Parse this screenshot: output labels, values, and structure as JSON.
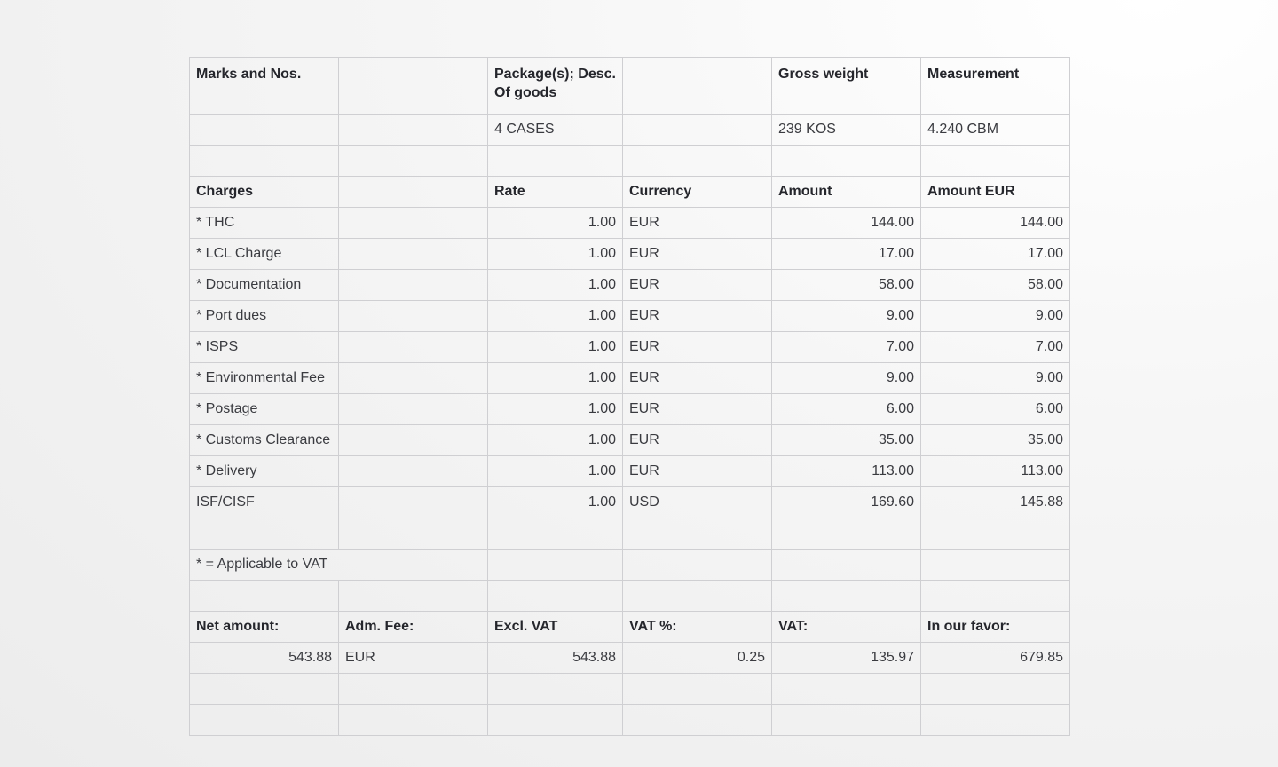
{
  "goods": {
    "headers": [
      "Marks and Nos.",
      "",
      "Package(s); Desc. Of goods",
      "",
      "Gross weight",
      "Measurement"
    ],
    "row": [
      "",
      "",
      "4 CASES",
      "",
      "239 KOS",
      "4.240 CBM"
    ]
  },
  "charges": {
    "headers": [
      "Charges",
      "",
      "Rate",
      "Currency",
      "Amount",
      "Amount EUR"
    ],
    "rows": [
      {
        "name": "* THC",
        "rate": "1.00",
        "currency": "EUR",
        "amount": "144.00",
        "amount_eur": "144.00"
      },
      {
        "name": "* LCL Charge",
        "rate": "1.00",
        "currency": "EUR",
        "amount": "17.00",
        "amount_eur": "17.00"
      },
      {
        "name": "* Documentation",
        "rate": "1.00",
        "currency": "EUR",
        "amount": "58.00",
        "amount_eur": "58.00"
      },
      {
        "name": "* Port dues",
        "rate": "1.00",
        "currency": "EUR",
        "amount": "9.00",
        "amount_eur": "9.00"
      },
      {
        "name": "* ISPS",
        "rate": "1.00",
        "currency": "EUR",
        "amount": "7.00",
        "amount_eur": "7.00"
      },
      {
        "name": "* Environmental Fee",
        "rate": "1.00",
        "currency": "EUR",
        "amount": "9.00",
        "amount_eur": "9.00"
      },
      {
        "name": "* Postage",
        "rate": "1.00",
        "currency": "EUR",
        "amount": "6.00",
        "amount_eur": "6.00"
      },
      {
        "name": "* Customs Clearance",
        "rate": "1.00",
        "currency": "EUR",
        "amount": "35.00",
        "amount_eur": "35.00"
      },
      {
        "name": "* Delivery",
        "rate": "1.00",
        "currency": "EUR",
        "amount": "113.00",
        "amount_eur": "113.00"
      },
      {
        "name": "ISF/CISF",
        "rate": "1.00",
        "currency": "USD",
        "amount": "169.60",
        "amount_eur": "145.88"
      }
    ]
  },
  "vat_note": "* = Applicable to VAT",
  "totals": {
    "headers": [
      "Net amount:",
      "Adm. Fee:",
      "Excl. VAT",
      "VAT %:",
      "VAT:",
      "In our favor:"
    ],
    "values": [
      "543.88",
      "EUR",
      "543.88",
      "0.25",
      "135.97",
      "679.85"
    ]
  }
}
